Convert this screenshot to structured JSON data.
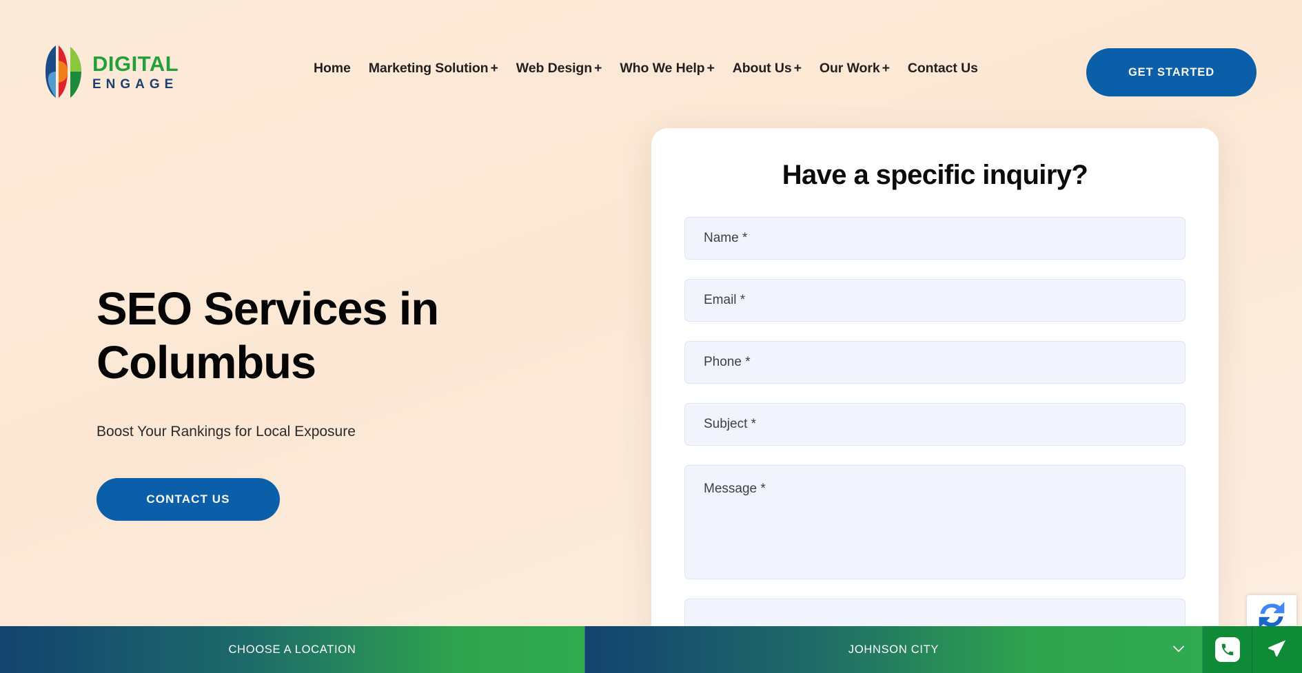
{
  "brand": {
    "name_line1": "DIGITAL",
    "name_line2": "ENGAGE",
    "green": "#23a03a",
    "navy": "#1d3f6e"
  },
  "header": {
    "nav_items": [
      {
        "label": "Home",
        "has_submenu": false
      },
      {
        "label": "Marketing Solution",
        "has_submenu": true
      },
      {
        "label": "Web Design",
        "has_submenu": true
      },
      {
        "label": "Who We Help",
        "has_submenu": true
      },
      {
        "label": "About Us",
        "has_submenu": true
      },
      {
        "label": "Our Work",
        "has_submenu": true
      },
      {
        "label": "Contact Us",
        "has_submenu": false
      }
    ],
    "submenu_indicator": "+",
    "cta_label": "GET STARTED",
    "cta_color": "#0a5fa8"
  },
  "hero": {
    "title": "SEO Services in Columbus",
    "subtitle": "Boost Your Rankings for Local Exposure",
    "button_label": "CONTACT US",
    "button_color": "#0a5fa8",
    "background_color": "#fbe7d4"
  },
  "form": {
    "title": "Have a specific inquiry?",
    "fields": [
      {
        "name": "name",
        "placeholder": "Name *",
        "type": "text"
      },
      {
        "name": "email",
        "placeholder": "Email *",
        "type": "text"
      },
      {
        "name": "phone",
        "placeholder": "Phone *",
        "type": "text"
      },
      {
        "name": "subject",
        "placeholder": "Subject *",
        "type": "text"
      },
      {
        "name": "message",
        "placeholder": "Message *",
        "type": "textarea"
      },
      {
        "name": "clipped",
        "placeholder": "",
        "type": "text"
      }
    ],
    "field_background": "#f1f4fd"
  },
  "bottom_bar": {
    "choose_location_label": "CHOOSE A LOCATION",
    "selected_location": "JOHNSON CITY",
    "chevron": "⌄",
    "gradient_from": "#13436f",
    "gradient_to": "#31ab50",
    "icon_button_color": "#0f8a37"
  }
}
